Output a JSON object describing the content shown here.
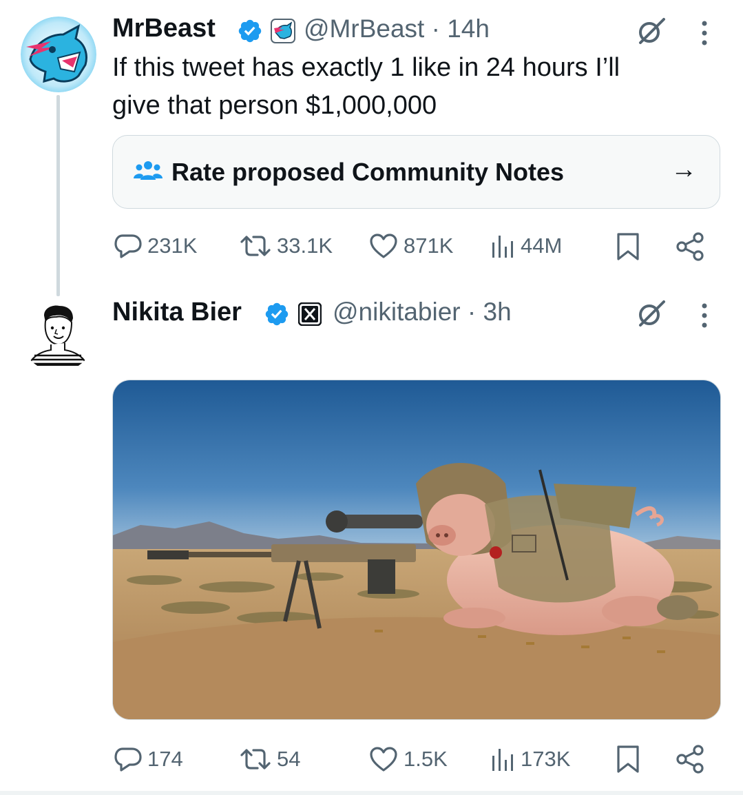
{
  "thread": [
    {
      "author_name": "MrBeast",
      "handle": "@MrBeast",
      "time": "14h",
      "separator": "·",
      "text_line1": "If this tweet has exactly 1 like in 24 hours I’ll",
      "text_line2": "give that person $1,000,000",
      "community_notes_label": "Rate proposed Community Notes",
      "community_notes_arrow": "→",
      "stats": {
        "replies": "231K",
        "reposts": "33.1K",
        "likes": "871K",
        "views": "44M"
      },
      "avatar_icon": "mrbeast-panther-logo-icon",
      "affiliate_badge_icon": "mrbeast-affiliate-badge-icon"
    },
    {
      "author_name": "Nikita Bier",
      "handle": "@nikitabier",
      "time": "3h",
      "separator": "·",
      "stats": {
        "replies": "174",
        "reposts": "54",
        "likes": "1.5K",
        "views": "173K"
      },
      "avatar_icon": "sketch-portrait-avatar-icon",
      "affiliate_badge_icon": "x-logo-badge-icon",
      "media_description_icon": "pig-sniper-photo"
    }
  ],
  "colors": {
    "text_primary": "#0f1419",
    "text_secondary": "#536471",
    "verified_blue": "#1d9bf0",
    "border": "#cfd9de",
    "notes_bg": "#f7f9f9"
  }
}
